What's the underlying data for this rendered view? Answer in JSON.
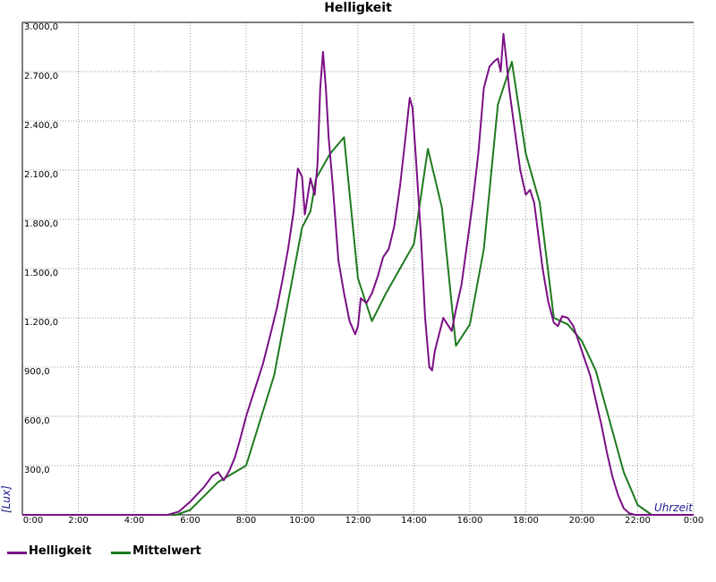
{
  "chart_data": {
    "type": "line",
    "title": "Helligkeit",
    "xlabel": "Uhrzeit",
    "ylabel": "[Lux]",
    "x_ticks": [
      "0:00",
      "2:00",
      "4:00",
      "6:00",
      "8:00",
      "10:00",
      "12:00",
      "14:00",
      "16:00",
      "18:00",
      "20:00",
      "22:00",
      "0:00"
    ],
    "y_ticks": [
      "0,0",
      "300,0",
      "600,0",
      "900,0",
      "1.200,0",
      "1.500,0",
      "1.800,0",
      "2.100,0",
      "2.400,0",
      "2.700,0",
      "3.000,0"
    ],
    "xlim": [
      0,
      24
    ],
    "ylim": [
      0,
      3000
    ],
    "grid": true,
    "legend_position": "bottom-left",
    "series": [
      {
        "name": "Helligkeit",
        "color": "#7b0f86",
        "points": [
          [
            0,
            0
          ],
          [
            5.2,
            0
          ],
          [
            5.6,
            20
          ],
          [
            6.0,
            80
          ],
          [
            6.5,
            170
          ],
          [
            6.8,
            240
          ],
          [
            7.0,
            260
          ],
          [
            7.2,
            210
          ],
          [
            7.4,
            270
          ],
          [
            7.6,
            350
          ],
          [
            7.8,
            470
          ],
          [
            8.0,
            600
          ],
          [
            8.3,
            760
          ],
          [
            8.6,
            920
          ],
          [
            8.9,
            1120
          ],
          [
            9.1,
            1260
          ],
          [
            9.3,
            1430
          ],
          [
            9.5,
            1620
          ],
          [
            9.7,
            1850
          ],
          [
            9.85,
            2110
          ],
          [
            10.0,
            2060
          ],
          [
            10.1,
            1830
          ],
          [
            10.3,
            2050
          ],
          [
            10.45,
            1950
          ],
          [
            10.55,
            2130
          ],
          [
            10.65,
            2600
          ],
          [
            10.75,
            2820
          ],
          [
            10.85,
            2600
          ],
          [
            10.95,
            2300
          ],
          [
            11.1,
            2000
          ],
          [
            11.3,
            1550
          ],
          [
            11.5,
            1350
          ],
          [
            11.7,
            1180
          ],
          [
            11.9,
            1100
          ],
          [
            12.0,
            1150
          ],
          [
            12.1,
            1320
          ],
          [
            12.3,
            1290
          ],
          [
            12.5,
            1350
          ],
          [
            12.7,
            1450
          ],
          [
            12.9,
            1570
          ],
          [
            13.1,
            1620
          ],
          [
            13.3,
            1760
          ],
          [
            13.5,
            2000
          ],
          [
            13.7,
            2300
          ],
          [
            13.85,
            2540
          ],
          [
            13.95,
            2480
          ],
          [
            14.1,
            2100
          ],
          [
            14.25,
            1700
          ],
          [
            14.4,
            1200
          ],
          [
            14.55,
            900
          ],
          [
            14.65,
            880
          ],
          [
            14.75,
            1000
          ],
          [
            14.9,
            1100
          ],
          [
            15.05,
            1200
          ],
          [
            15.2,
            1160
          ],
          [
            15.35,
            1120
          ],
          [
            15.5,
            1250
          ],
          [
            15.7,
            1400
          ],
          [
            15.9,
            1650
          ],
          [
            16.1,
            1900
          ],
          [
            16.3,
            2200
          ],
          [
            16.5,
            2600
          ],
          [
            16.7,
            2730
          ],
          [
            16.85,
            2760
          ],
          [
            17.0,
            2780
          ],
          [
            17.1,
            2700
          ],
          [
            17.2,
            2930
          ],
          [
            17.3,
            2780
          ],
          [
            17.4,
            2600
          ],
          [
            17.6,
            2350
          ],
          [
            17.8,
            2100
          ],
          [
            18.0,
            1950
          ],
          [
            18.15,
            1980
          ],
          [
            18.3,
            1900
          ],
          [
            18.45,
            1700
          ],
          [
            18.6,
            1500
          ],
          [
            18.8,
            1300
          ],
          [
            19.0,
            1170
          ],
          [
            19.15,
            1150
          ],
          [
            19.3,
            1210
          ],
          [
            19.5,
            1200
          ],
          [
            19.7,
            1150
          ],
          [
            19.9,
            1050
          ],
          [
            20.1,
            950
          ],
          [
            20.3,
            850
          ],
          [
            20.5,
            700
          ],
          [
            20.7,
            550
          ],
          [
            20.9,
            380
          ],
          [
            21.1,
            230
          ],
          [
            21.3,
            120
          ],
          [
            21.5,
            40
          ],
          [
            21.7,
            10
          ],
          [
            21.9,
            0
          ],
          [
            24,
            0
          ]
        ]
      },
      {
        "name": "Mittelwert",
        "color": "#1f7a1f",
        "points": [
          [
            0,
            0
          ],
          [
            5.5,
            0
          ],
          [
            6.0,
            30
          ],
          [
            7.0,
            200
          ],
          [
            8.0,
            300
          ],
          [
            9.0,
            850
          ],
          [
            10.0,
            1750
          ],
          [
            10.3,
            1850
          ],
          [
            10.5,
            2050
          ],
          [
            11.0,
            2200
          ],
          [
            11.5,
            2300
          ],
          [
            12.0,
            1440
          ],
          [
            12.5,
            1180
          ],
          [
            13.0,
            1350
          ],
          [
            14.0,
            1650
          ],
          [
            14.5,
            2230
          ],
          [
            15.0,
            1870
          ],
          [
            15.5,
            1030
          ],
          [
            16.0,
            1160
          ],
          [
            16.5,
            1620
          ],
          [
            17.0,
            2500
          ],
          [
            17.5,
            2760
          ],
          [
            18.0,
            2200
          ],
          [
            18.5,
            1900
          ],
          [
            19.0,
            1200
          ],
          [
            19.5,
            1160
          ],
          [
            20.0,
            1060
          ],
          [
            20.5,
            880
          ],
          [
            21.0,
            570
          ],
          [
            21.5,
            260
          ],
          [
            22.0,
            60
          ],
          [
            22.5,
            0
          ],
          [
            24,
            0
          ]
        ]
      }
    ]
  }
}
